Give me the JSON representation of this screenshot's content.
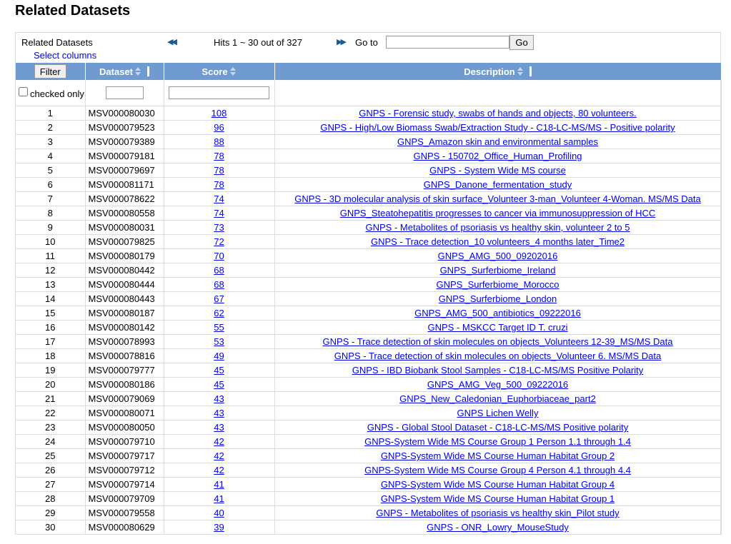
{
  "page": {
    "title": "Related Datasets"
  },
  "toolbar": {
    "title": "Related Datasets",
    "select_columns": "Select columns",
    "hits": "Hits 1 ~ 30 out of 327",
    "goto_label": "Go to",
    "goto_value": "",
    "go_label": "Go"
  },
  "table": {
    "filter_label": "Filter",
    "checked_only": "checked only",
    "columns": {
      "dataset": "Dataset",
      "score": "Score",
      "description": "Description"
    },
    "rows": [
      {
        "n": "1",
        "id": "MSV000080030",
        "score": "108",
        "desc": "GNPS - Forensic study, swabs of hands and objects, 80 volunteers."
      },
      {
        "n": "2",
        "id": "MSV000079523",
        "score": "96",
        "desc": "GNPS - High/Low Biomass Swab/Extraction Study - C18-LC-MS/MS - Positive polarity"
      },
      {
        "n": "3",
        "id": "MSV000079389",
        "score": "88",
        "desc": "GNPS_Amazon skin and environmental samples"
      },
      {
        "n": "4",
        "id": "MSV000079181",
        "score": "78",
        "desc": "GNPS - 150702_Office_Human_Profiling"
      },
      {
        "n": "5",
        "id": "MSV000079697",
        "score": "78",
        "desc": "GNPS - System Wide MS course"
      },
      {
        "n": "6",
        "id": "MSV000081171",
        "score": "78",
        "desc": "GNPS_Danone_fermentation_study"
      },
      {
        "n": "7",
        "id": "MSV000078622",
        "score": "74",
        "desc": "GNPS - 3D molecular analysis of skin surface_Volunteer 3-man_Volunteer 4-Woman. MS/MS Data"
      },
      {
        "n": "8",
        "id": "MSV000080558",
        "score": "74",
        "desc": "GNPS_Steatohepatitis progresses to cancer via immunosuppression of HCC"
      },
      {
        "n": "9",
        "id": "MSV000080031",
        "score": "73",
        "desc": "GNPS - Metabolites of psoriasis vs healthy skin, volunteer 2 to 5"
      },
      {
        "n": "10",
        "id": "MSV000079825",
        "score": "72",
        "desc": "GNPS - Trace detection_10 volunteers_4 months later_Time2"
      },
      {
        "n": "11",
        "id": "MSV000080179",
        "score": "70",
        "desc": "GNPS_AMG_500_09202016"
      },
      {
        "n": "12",
        "id": "MSV000080442",
        "score": "68",
        "desc": "GNPS_Surferbiome_Ireland"
      },
      {
        "n": "13",
        "id": "MSV000080444",
        "score": "68",
        "desc": "GNPS_Surferbiome_Morocco"
      },
      {
        "n": "14",
        "id": "MSV000080443",
        "score": "67",
        "desc": "GNPS_Surferbiome_London"
      },
      {
        "n": "15",
        "id": "MSV000080187",
        "score": "62",
        "desc": "GNPS_AMG_500_antibiotics_09222016"
      },
      {
        "n": "16",
        "id": "MSV000080142",
        "score": "55",
        "desc": "GNPS - MSKCC Target ID T. cruzi"
      },
      {
        "n": "17",
        "id": "MSV000078993",
        "score": "53",
        "desc": "GNPS - Trace detection of skin molecules on objects_Volunteers 12-39_MS/MS Data"
      },
      {
        "n": "18",
        "id": "MSV000078816",
        "score": "49",
        "desc": "GNPS - Trace detection of skin molecules on objects_Volunteer 6. MS/MS Data"
      },
      {
        "n": "19",
        "id": "MSV000079777",
        "score": "45",
        "desc": "GNPS - IBD Biobank Stool Samples - C18-LC-MS/MS Positive Polarity"
      },
      {
        "n": "20",
        "id": "MSV000080186",
        "score": "45",
        "desc": "GNPS_AMG_Veg_500_09222016"
      },
      {
        "n": "21",
        "id": "MSV000079069",
        "score": "43",
        "desc": "GNPS_New_Caledonian_Euphorbiaceae_part2"
      },
      {
        "n": "22",
        "id": "MSV000080071",
        "score": "43",
        "desc": "GNPS Lichen Welly"
      },
      {
        "n": "23",
        "id": "MSV000080050",
        "score": "43",
        "desc": "GNPS - Global Stool Dataset - C18-LC-MS/MS Positive polarity"
      },
      {
        "n": "24",
        "id": "MSV000079710",
        "score": "42",
        "desc": "GNPS-System Wide MS Course Group 1 Person 1.1 through 1.4"
      },
      {
        "n": "25",
        "id": "MSV000079717",
        "score": "42",
        "desc": "GNPS-System Wide MS Course Human Habitat Group 2"
      },
      {
        "n": "26",
        "id": "MSV000079712",
        "score": "42",
        "desc": "GNPS-System Wide MS Course Group 4 Person 4.1 through 4.4"
      },
      {
        "n": "27",
        "id": "MSV000079714",
        "score": "41",
        "desc": "GNPS-System Wide MS Course Human Habitat Group 4"
      },
      {
        "n": "28",
        "id": "MSV000079709",
        "score": "41",
        "desc": "GNPS-System Wide MS Course Human Habitat Group 1"
      },
      {
        "n": "29",
        "id": "MSV000079558",
        "score": "40",
        "desc": "GNPS - Metabolites of psoriasis vs healthy skin_Pilot study"
      },
      {
        "n": "30",
        "id": "MSV000080629",
        "score": "39",
        "desc": "GNPS - ONR_Lowry_MouseStudy"
      }
    ]
  },
  "icons": {
    "prev": "double-chevron-left-icon",
    "next": "double-chevron-right-icon",
    "sort": "sort-up-down-icon"
  },
  "colors": {
    "header_bg": "#6f9bd1",
    "link": "#0000ee",
    "nav_icon": "#1a5a9a"
  }
}
